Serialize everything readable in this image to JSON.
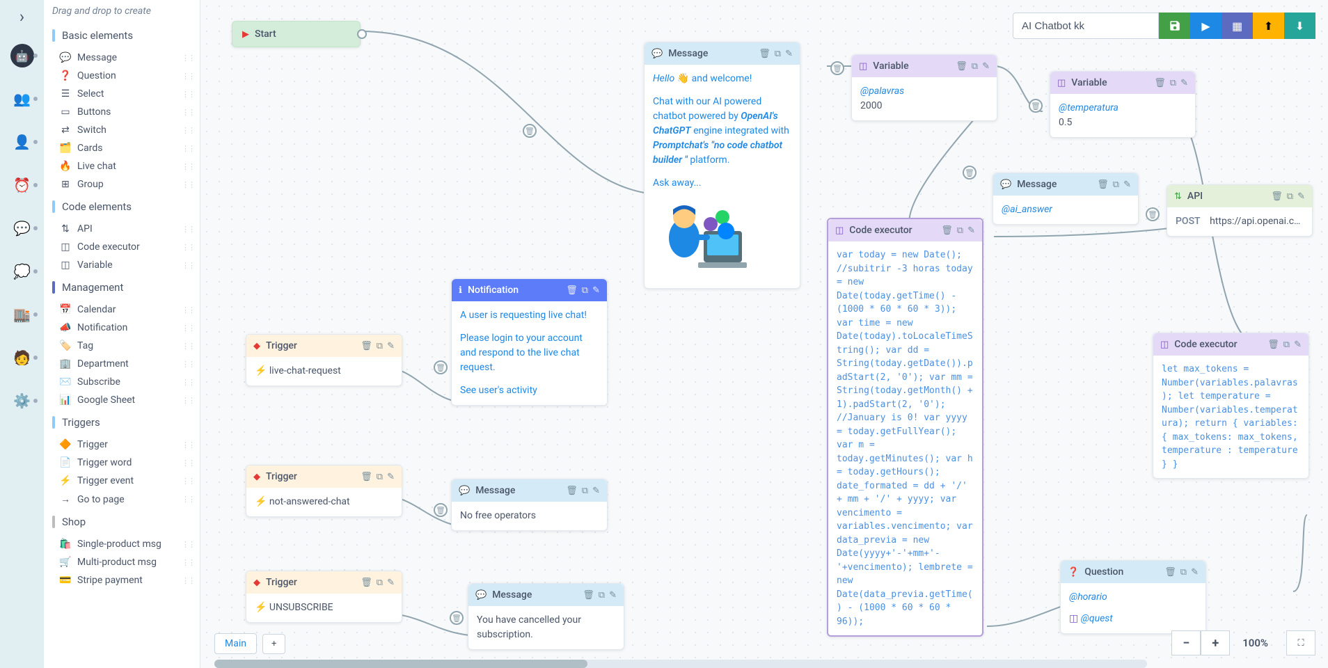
{
  "sidebar": {
    "hint": "Drag and drop to create",
    "sections": {
      "basic": {
        "label": "Basic elements"
      },
      "code": {
        "label": "Code elements"
      },
      "mgmt": {
        "label": "Management"
      },
      "triggers": {
        "label": "Triggers"
      },
      "shop": {
        "label": "Shop"
      }
    },
    "items": {
      "message": "Message",
      "question": "Question",
      "select": "Select",
      "buttons": "Buttons",
      "switch": "Switch",
      "cards": "Cards",
      "livechat": "Live chat",
      "group": "Group",
      "api": "API",
      "codeexec": "Code executor",
      "variable": "Variable",
      "calendar": "Calendar",
      "notification": "Notification",
      "tag": "Tag",
      "department": "Department",
      "subscribe": "Subscribe",
      "gsheet": "Google Sheet",
      "trigger": "Trigger",
      "triggerword": "Trigger word",
      "triggerevent": "Trigger event",
      "gotopage": "Go to page",
      "singleprod": "Single-product msg",
      "multiprod": "Multi-product msg",
      "stripe": "Stripe payment"
    }
  },
  "toolbar": {
    "title": "AI Chatbot kk"
  },
  "nodes": {
    "start": {
      "label": "Start"
    },
    "trigger1": {
      "label": "Trigger",
      "value": "live-chat-request"
    },
    "trigger2": {
      "label": "Trigger",
      "value": "not-answered-chat"
    },
    "trigger3": {
      "label": "Trigger",
      "value": "UNSUBSCRIBE"
    },
    "notification": {
      "label": "Notification",
      "body1": "A user is requesting live chat!",
      "body2": "Please login to your account and respond to the live chat request.",
      "link": "See user's activity"
    },
    "msg_noop": {
      "label": "Message",
      "body": "No free operators"
    },
    "msg_cancel": {
      "label": "Message",
      "body": "You have cancelled your subscription."
    },
    "msg_welcome": {
      "label": "Message",
      "hello": "Hello",
      "welcome": " and welcome!",
      "line1": "Chat with our AI powered chatbot powered by ",
      "openai": "OpenAI's ChatGPT",
      "line2": " engine integrated with ",
      "prompt": "Promptchat's \"no code chatbot builder \"",
      "line3": "platform.",
      "ask": "Ask away..."
    },
    "var_palavras": {
      "label": "Variable",
      "ref": "@palavras",
      "val": "2000"
    },
    "var_temp": {
      "label": "Variable",
      "ref": "@temperatura",
      "val": "0.5"
    },
    "msg_ai": {
      "label": "Message",
      "ref": "@ai_answer"
    },
    "api": {
      "label": "API",
      "method": "POST",
      "url": "https://api.openai.c…"
    },
    "code1": {
      "label": "Code executor",
      "body": "var today = new Date(); //subitrir -3 horas today = new Date(today.getTime() - (1000 * 60 * 60 * 3)); var time = new Date(today).toLocaleTimeString(); var dd = String(today.getDate()).padStart(2, '0'); var mm = String(today.getMonth() + 1).padStart(2, '0'); //January is 0! var yyyy = today.getFullYear(); var m = today.getMinutes(); var h = today.getHours(); date_formated = dd + '/' + mm + '/' + yyyy; var vencimento = variables.vencimento; var data_previa = new Date(yyyy+'-'+mm+'-'+vencimento); lembrete = new Date(data_previa.getTime() - (1000 * 60 * 60 * 96));"
    },
    "code2": {
      "label": "Code executor",
      "body": "let max_tokens = Number(variables.palavras); let temperature = Number(variables.temperatura); return { variables: { max_tokens: max_tokens, temperature : temperature } }"
    },
    "question": {
      "label": "Question",
      "ref1": "@horario",
      "ref2": "@quest"
    }
  },
  "bottom": {
    "tab": "Main",
    "add": "+"
  },
  "zoom": {
    "level": "100%"
  }
}
